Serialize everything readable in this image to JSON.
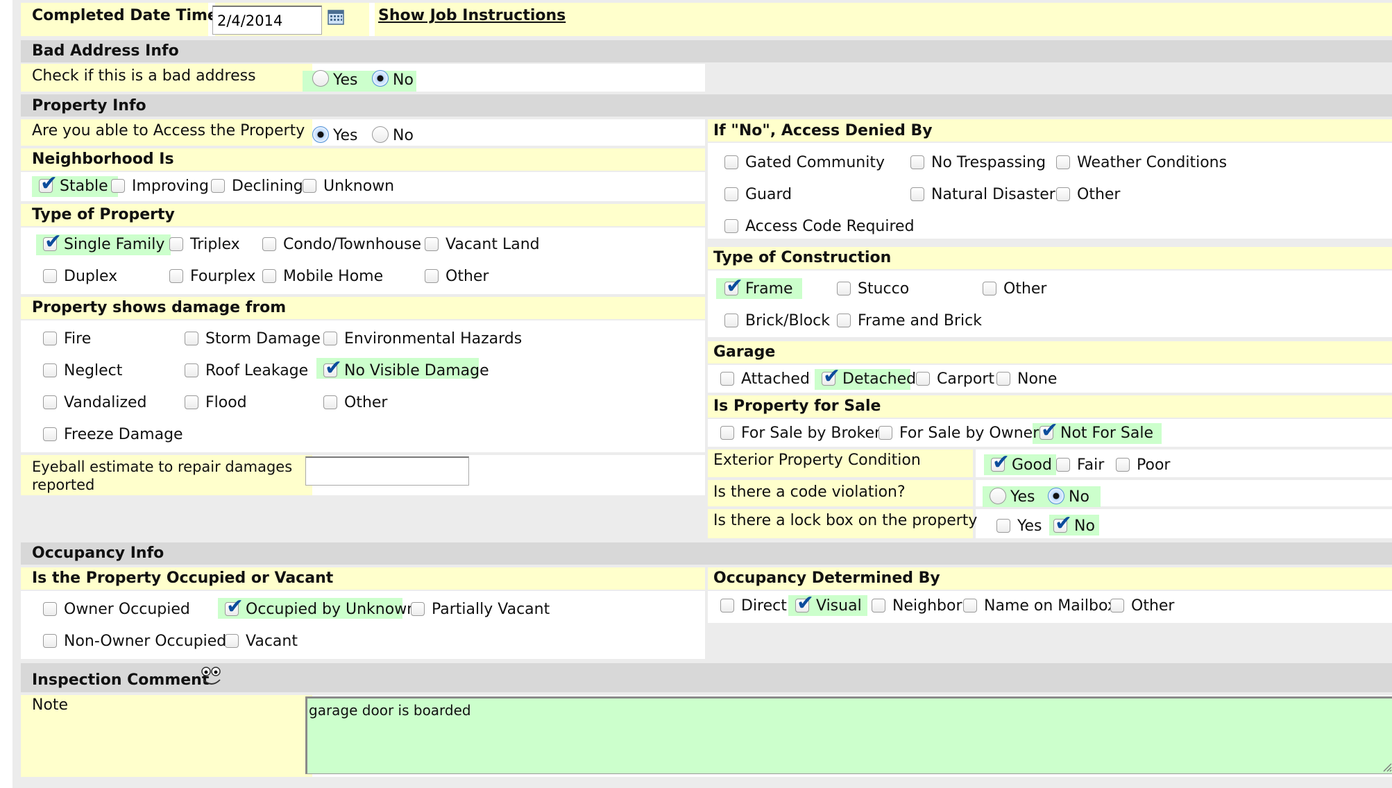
{
  "header": {
    "completed_label": "Completed Date Time",
    "completed_value": "2/4/2014",
    "calendar_icon": "calendar-icon",
    "show_instructions": "Show Job Instructions"
  },
  "bad_address": {
    "section": "Bad Address Info",
    "question": "Check if this is a bad address",
    "yes": "Yes",
    "no": "No",
    "selected": "No"
  },
  "property": {
    "section": "Property Info",
    "access_question": "Are you able to Access the Property",
    "access_yes": "Yes",
    "access_no": "No",
    "access_selected": "Yes",
    "neighborhood": {
      "title": "Neighborhood Is",
      "options": [
        "Stable",
        "Improving",
        "Declining",
        "Unknown"
      ],
      "checked": [
        "Stable"
      ]
    },
    "type": {
      "title": "Type of Property",
      "options": [
        "Single Family",
        "Triplex",
        "Condo/Townhouse",
        "Vacant Land",
        "Duplex",
        "Fourplex",
        "Mobile Home",
        "Other"
      ],
      "checked": [
        "Single Family"
      ]
    },
    "damage": {
      "title": "Property shows damage from",
      "options": [
        "Fire",
        "Storm Damage",
        "Environmental Hazards",
        "Neglect",
        "Roof Leakage",
        "No Visible Damage",
        "Vandalized",
        "Flood",
        "Other",
        "Freeze Damage"
      ],
      "checked": [
        "No Visible Damage"
      ]
    },
    "eyeball_label": "Eyeball estimate to repair damages reported",
    "eyeball_value": "",
    "denied": {
      "title": "If \"No\", Access Denied By",
      "options": [
        "Gated Community",
        "No Trespassing",
        "Weather Conditions",
        "Guard",
        "Natural Disaster",
        "Other",
        "Access Code Required"
      ]
    },
    "construction": {
      "title": "Type of Construction",
      "options": [
        "Frame",
        "Stucco",
        "Other",
        "Brick/Block",
        "Frame and Brick"
      ],
      "checked": [
        "Frame"
      ]
    },
    "garage": {
      "title": "Garage",
      "options": [
        "Attached",
        "Detached",
        "Carport",
        "None"
      ],
      "checked": [
        "Detached"
      ]
    },
    "for_sale": {
      "title": "Is Property for Sale",
      "options": [
        "For Sale by Broker",
        "For Sale by Owner",
        "Not For Sale"
      ],
      "checked": [
        "Not For Sale"
      ]
    },
    "exterior": {
      "label": "Exterior Property Condition",
      "options": [
        "Good",
        "Fair",
        "Poor"
      ],
      "checked": [
        "Good"
      ]
    },
    "code_violation": {
      "label": "Is there a code violation?",
      "yes": "Yes",
      "no": "No",
      "selected": "No"
    },
    "lock_box": {
      "label": "Is there a lock box on the property",
      "yes": "Yes",
      "no": "No",
      "checked": [
        "No"
      ]
    }
  },
  "occupancy": {
    "section": "Occupancy Info",
    "status": {
      "title": "Is the Property Occupied or Vacant",
      "options": [
        "Owner Occupied",
        "Occupied by Unknown",
        "Partially Vacant",
        "Non-Owner Occupied",
        "Vacant"
      ],
      "checked": [
        "Occupied by Unknown"
      ]
    },
    "determined": {
      "title": "Occupancy Determined By",
      "options": [
        "Direct",
        "Visual",
        "Neighbor",
        "Name on Mailbox",
        "Other"
      ],
      "checked": [
        "Visual"
      ]
    }
  },
  "comment": {
    "section": "Inspection Comment",
    "icon": "spellcheck-face-icon",
    "note_label": "Note",
    "note_value": "garage door is boarded"
  },
  "colors": {
    "label_bg": "#ffffcc",
    "selected_bg": "#ccffcc",
    "section_bg": "#d8d8d8",
    "check_color": "#0c4d9c"
  }
}
